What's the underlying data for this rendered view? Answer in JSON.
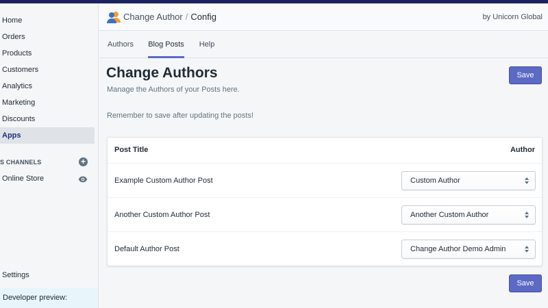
{
  "sidebar": {
    "items": [
      {
        "label": "Home"
      },
      {
        "label": "Orders"
      },
      {
        "label": "Products"
      },
      {
        "label": "Customers"
      },
      {
        "label": "Analytics"
      },
      {
        "label": "Marketing"
      },
      {
        "label": "Discounts"
      },
      {
        "label": "Apps"
      }
    ],
    "sales_channels_header": "S CHANNELS",
    "online_store": "Online Store",
    "settings": "Settings",
    "developer_preview": "Developer preview:"
  },
  "header": {
    "app_name": "Change Author",
    "separator": "/",
    "page": "Config",
    "by_line": "by Unicorn Global"
  },
  "tabs": [
    {
      "label": "Authors",
      "active": false
    },
    {
      "label": "Blog Posts",
      "active": true
    },
    {
      "label": "Help",
      "active": false
    }
  ],
  "main": {
    "title": "Change Authors",
    "subtitle": "Manage the Authors of your Posts here.",
    "reminder": "Remember to save after updating the posts!",
    "save_label": "Save"
  },
  "table": {
    "headers": {
      "title": "Post Title",
      "author": "Author"
    },
    "rows": [
      {
        "title": "Example Custom Author Post",
        "author": "Custom Author"
      },
      {
        "title": "Another Custom Author Post",
        "author": "Another Custom Author"
      },
      {
        "title": "Default Author Post",
        "author": "Change Author Demo Admin"
      }
    ]
  },
  "colors": {
    "accent": "#5c6ac4",
    "topbar": "#1c2260",
    "active_nav_text": "#202e78"
  }
}
